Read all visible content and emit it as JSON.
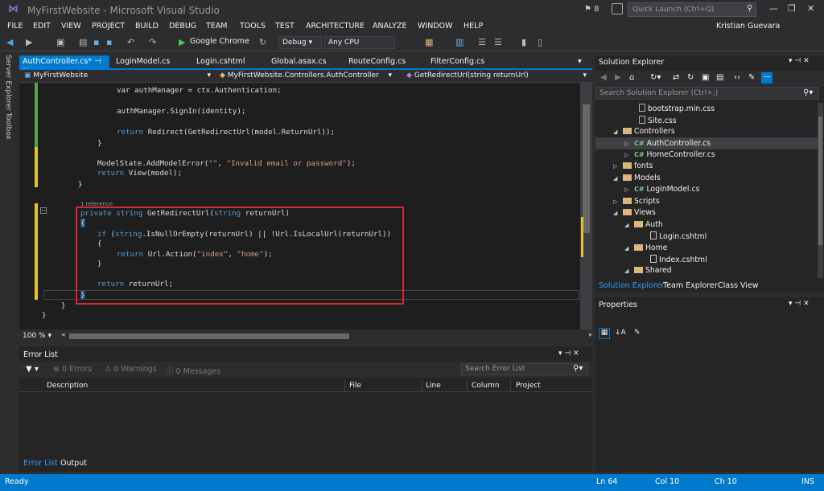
{
  "window": {
    "title": "MyFirstWebsite - Microsoft Visual Studio",
    "notification_count": "8",
    "quick_launch_placeholder": "Quick Launch (Ctrl+Q)",
    "user": "Kristian Guevara"
  },
  "menu": [
    "FILE",
    "EDIT",
    "VIEW",
    "PROJECT",
    "BUILD",
    "DEBUG",
    "TEAM",
    "TOOLS",
    "TEST",
    "ARCHITECTURE",
    "ANALYZE",
    "WINDOW",
    "HELP"
  ],
  "toolbar": {
    "run_target": "Google Chrome",
    "configuration": "Debug",
    "platform": "Any CPU"
  },
  "left_strip": [
    "Server Explorer",
    "Toolbox"
  ],
  "tabs": [
    {
      "label": "AuthController.cs*",
      "active": true
    },
    {
      "label": "LoginModel.cs",
      "active": false
    },
    {
      "label": "Login.cshtml",
      "active": false
    },
    {
      "label": "Global.asax.cs",
      "active": false
    },
    {
      "label": "RouteConfig.cs",
      "active": false
    },
    {
      "label": "FilterConfig.cs",
      "active": false
    }
  ],
  "navbar": {
    "project": "MyFirstWebsite",
    "class": "MyFirstWebsite.Controllers.AuthController",
    "member": "GetRedirectUrl(string returnUrl)"
  },
  "code": {
    "line1": "var authManager = ctx.Authentication;",
    "line2": "authManager.SignIn(identity);",
    "line3_kw": "return",
    "line3": " Redirect(GetRedirectUrl(model.ReturnUrl));",
    "brace_close_1": "}",
    "line4a": "ModelState.AddModelError(",
    "line4_s1": "\"\"",
    "line4b": ", ",
    "line4_s2": "\"Invalid email or password\"",
    "line4c": ");",
    "line5_kw": "return",
    "line5": " View(model);",
    "brace_close_2": "}",
    "reference": "1 reference",
    "sig_kw1": "private",
    "sig_kw2": "string",
    "sig_name": " GetRedirectUrl(",
    "sig_kw3": "string",
    "sig_param": " returnUrl)",
    "open_brace": "{",
    "if_kw": "if",
    "if_a": " (",
    "if_kw2": "string",
    "if_b": ".IsNullOrEmpty(returnUrl) || !Url.IsLocalUrl(returnUrl))",
    "open_brace_2": "{",
    "ret_kw": "return",
    "ret_a": " Url.Action(",
    "ret_s1": "\"index\"",
    "ret_b": ", ",
    "ret_s2": "\"home\"",
    "ret_c": ");",
    "close_brace_3": "}",
    "ret2_kw": "return",
    "ret2": " returnUrl;",
    "close_brace_4": "}",
    "close_brace_5": "}",
    "close_brace_6": "}"
  },
  "editor": {
    "zoom": "100 %"
  },
  "error_list": {
    "title": "Error List",
    "errors": "0 Errors",
    "warnings": "0 Warnings",
    "messages": "0 Messages",
    "search_placeholder": "Search Error List",
    "columns": [
      "Description",
      "File",
      "Line",
      "Column",
      "Project"
    ]
  },
  "bottom_tabs": [
    "Error List",
    "Output"
  ],
  "solution_explorer": {
    "title": "Solution Explorer",
    "search_placeholder": "Search Solution Explorer (Ctrl+;)",
    "items": [
      {
        "label": "bootstrap.min.css",
        "kind": "css"
      },
      {
        "label": "Site.css",
        "kind": "css"
      },
      {
        "label": "Controllers",
        "kind": "folder"
      },
      {
        "label": "AuthController.cs",
        "kind": "cs"
      },
      {
        "label": "HomeController.cs",
        "kind": "cs"
      },
      {
        "label": "fonts",
        "kind": "folder"
      },
      {
        "label": "Models",
        "kind": "folder"
      },
      {
        "label": "LoginModel.cs",
        "kind": "cs"
      },
      {
        "label": "Scripts",
        "kind": "folder"
      },
      {
        "label": "Views",
        "kind": "folder"
      },
      {
        "label": "Auth",
        "kind": "folder"
      },
      {
        "label": "Login.cshtml",
        "kind": "file"
      },
      {
        "label": "Home",
        "kind": "folder"
      },
      {
        "label": "Index.cshtml",
        "kind": "file"
      },
      {
        "label": "Shared",
        "kind": "folder"
      }
    ],
    "tabs": [
      "Solution Explorer",
      "Team Explorer",
      "Class View"
    ]
  },
  "properties": {
    "title": "Properties"
  },
  "status": {
    "state": "Ready",
    "line": "Ln 64",
    "col": "Col 10",
    "ch": "Ch 10",
    "mode": "INS"
  },
  "colors": {
    "accent": "#007acc",
    "highlight_box": "#d9282c",
    "background": "#2d2d30",
    "editor_bg": "#1e1e1e"
  }
}
